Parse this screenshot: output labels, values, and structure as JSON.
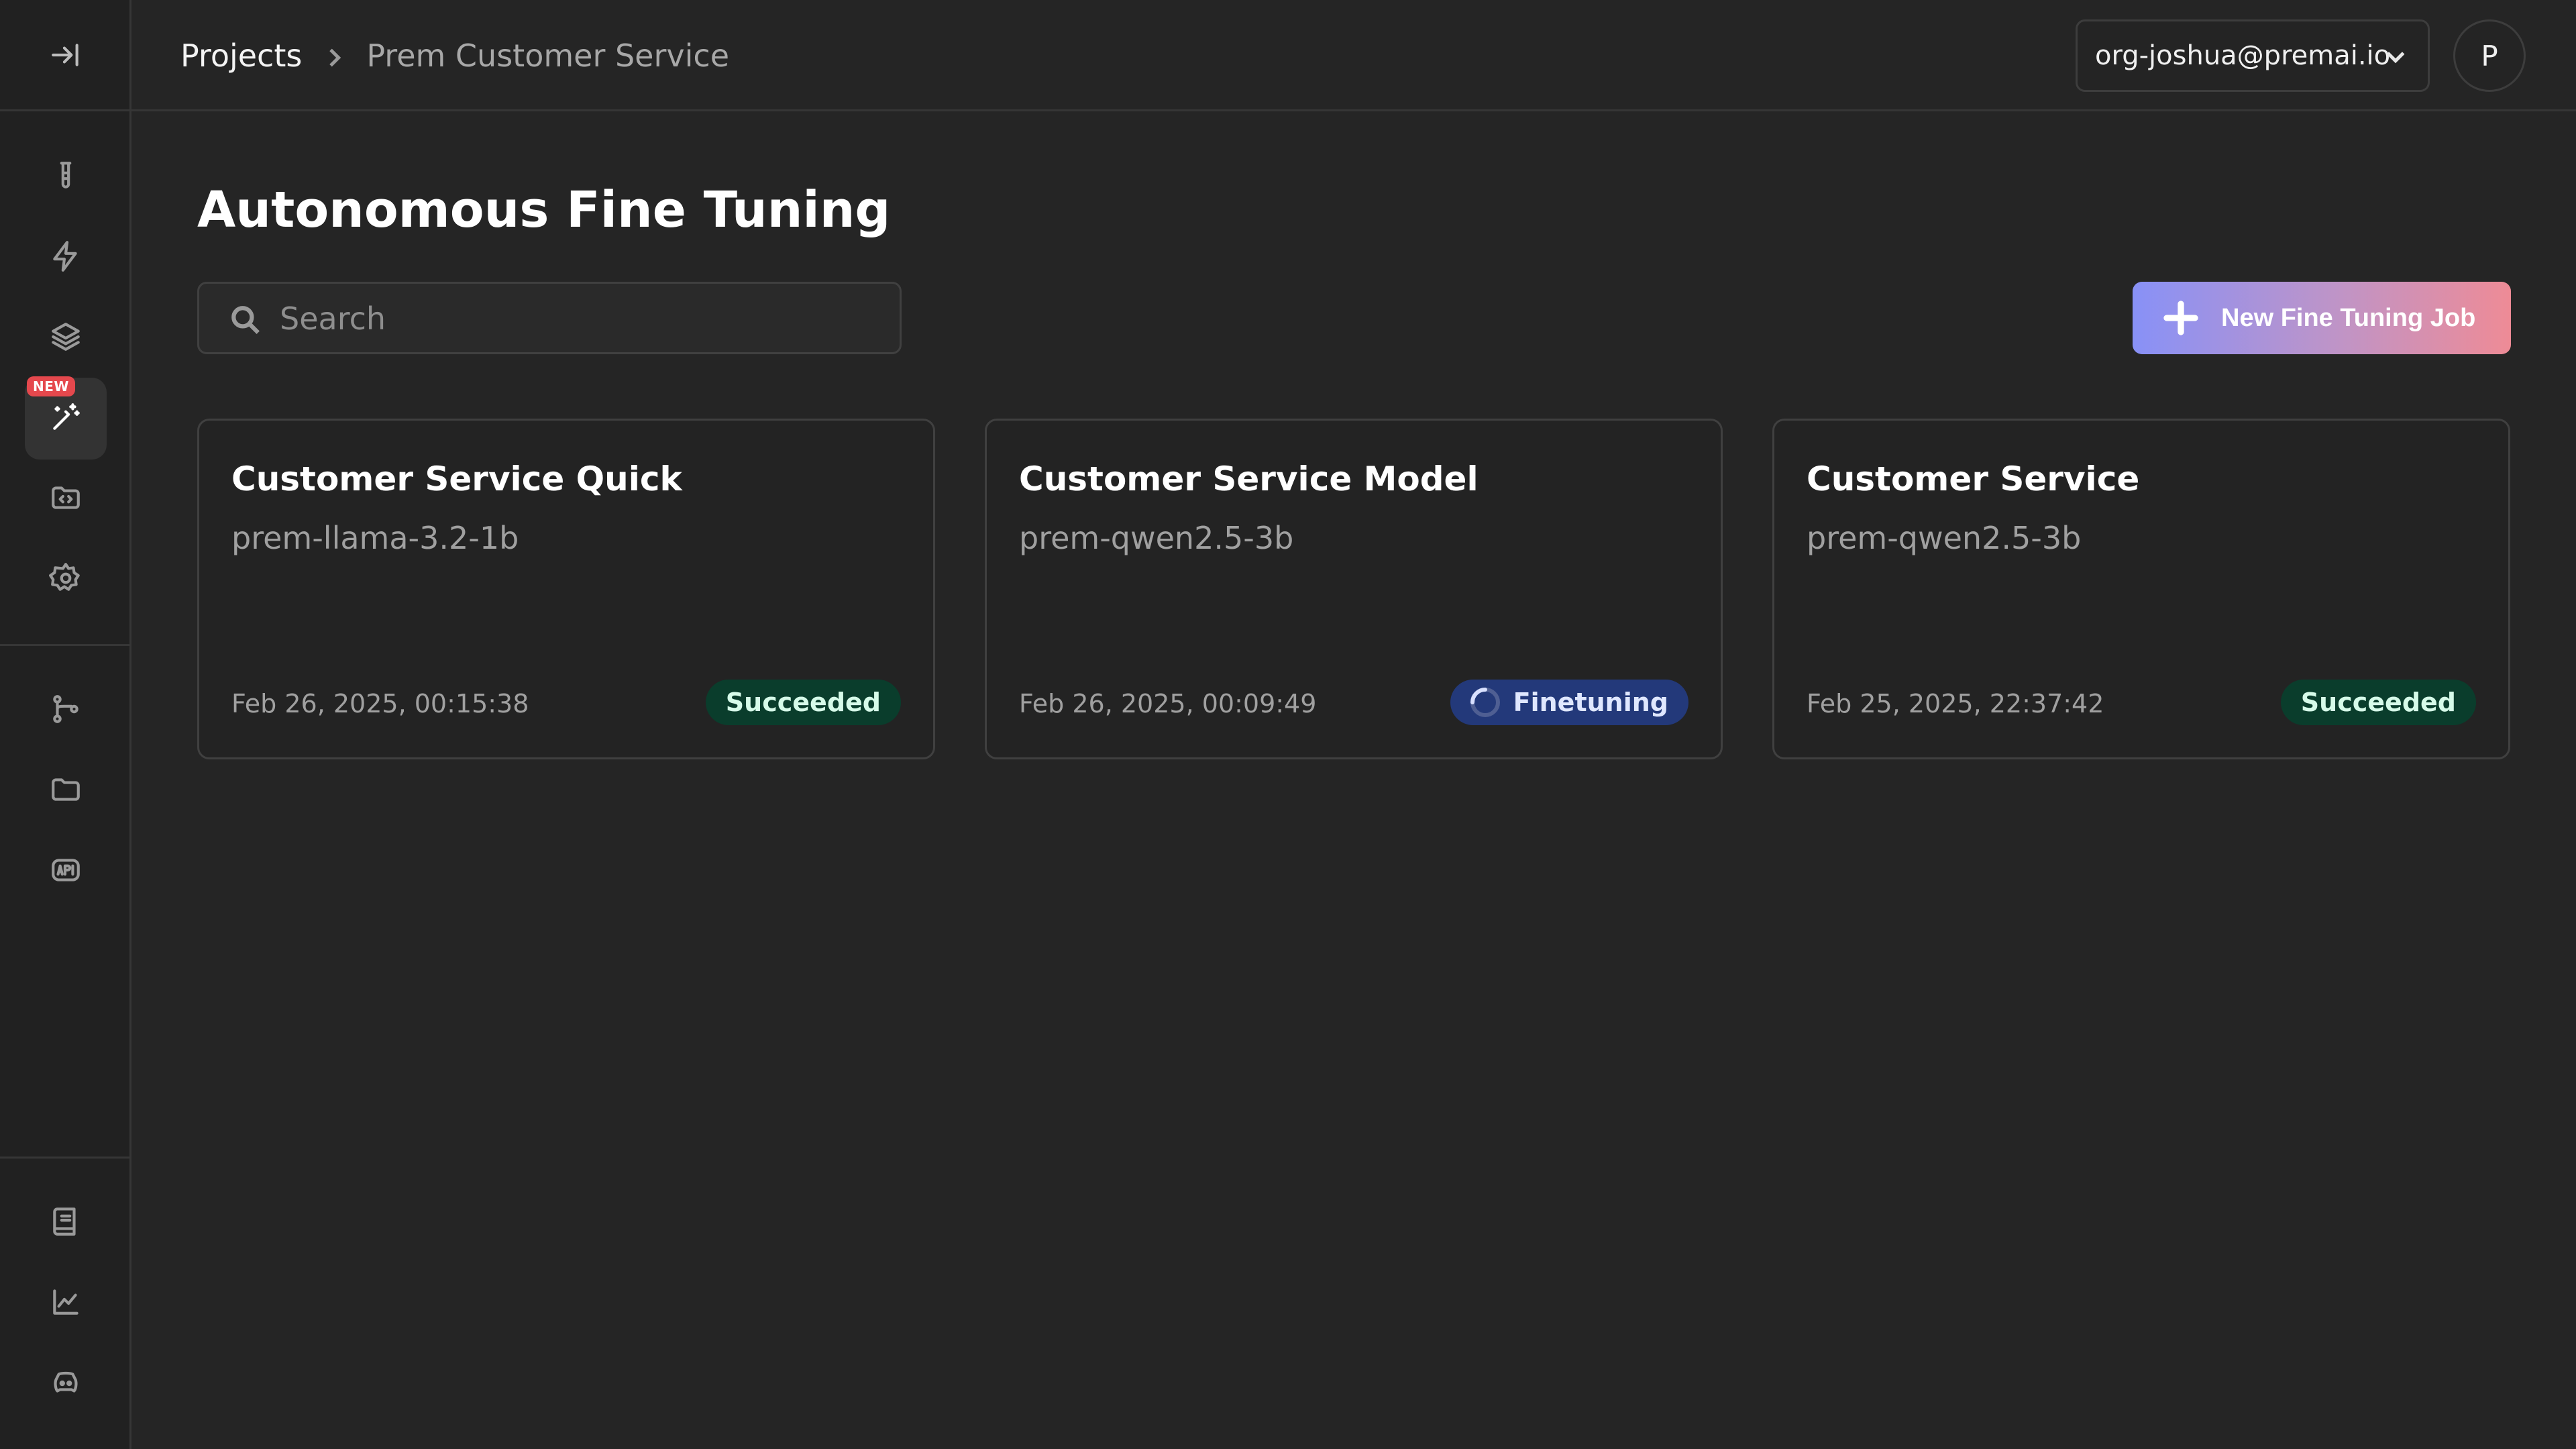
{
  "sidebar": {
    "collapse_icon": "collapse-right-icon",
    "new_badge": "NEW",
    "items": [
      {
        "icon": "test-tube-icon"
      },
      {
        "icon": "bolt-icon"
      },
      {
        "icon": "layers-icon"
      },
      {
        "icon": "magic-wand-icon",
        "active": true
      },
      {
        "icon": "code-folder-icon"
      },
      {
        "icon": "gear-icon"
      },
      {
        "icon": "git-branch-icon"
      },
      {
        "icon": "folder-icon"
      },
      {
        "icon": "api-icon"
      },
      {
        "icon": "notebook-icon"
      },
      {
        "icon": "chart-line-icon"
      },
      {
        "icon": "discord-icon"
      }
    ]
  },
  "header": {
    "breadcrumb_root": "Projects",
    "breadcrumb_current": "Prem Customer Service",
    "org": "org-joshua@premai.io",
    "avatar_initial": "P"
  },
  "main": {
    "title": "Autonomous Fine Tuning",
    "search_placeholder": "Search",
    "new_job_label": "New Fine Tuning Job"
  },
  "jobs": [
    {
      "title": "Customer Service Quick",
      "model": "prem-llama-3.2-1b",
      "date": "Feb 26, 2025, 00:15:38",
      "status": "Succeeded"
    },
    {
      "title": "Customer Service Model",
      "model": "prem-qwen2.5-3b",
      "date": "Feb 26, 2025, 00:09:49",
      "status": "Finetuning"
    },
    {
      "title": "Customer Service",
      "model": "prem-qwen2.5-3b",
      "date": "Feb 25, 2025, 22:37:42",
      "status": "Succeeded"
    }
  ],
  "colors": {
    "background": "#252525",
    "success_badge": "#0a3d2c",
    "running_badge": "#23397a",
    "cta_gradient_start": "#8891f7",
    "cta_gradient_end": "#ee8b96"
  }
}
